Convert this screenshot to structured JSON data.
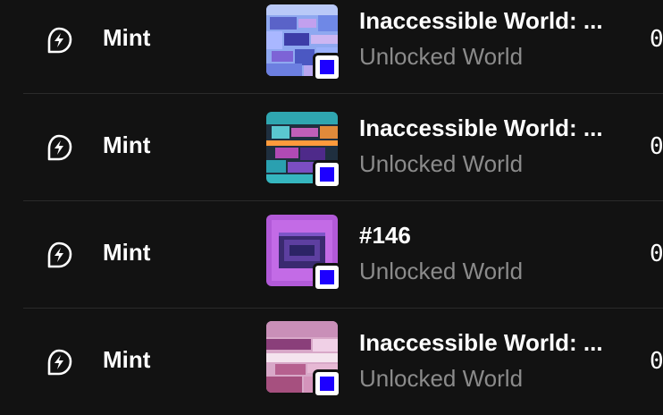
{
  "rows": [
    {
      "event_icon": "mint-lightning-leaf-icon",
      "event_label": "Mint",
      "item_name": "Inaccessible World: ...",
      "collection": "Unlocked World",
      "chain_badge_color": "#1d00ff",
      "price_partial": "0"
    },
    {
      "event_icon": "mint-lightning-leaf-icon",
      "event_label": "Mint",
      "item_name": "Inaccessible World: ...",
      "collection": "Unlocked World",
      "chain_badge_color": "#1d00ff",
      "price_partial": "0"
    },
    {
      "event_icon": "mint-lightning-leaf-icon",
      "event_label": "Mint",
      "item_name": "#146",
      "collection": "Unlocked World",
      "chain_badge_color": "#1d00ff",
      "price_partial": "0"
    },
    {
      "event_icon": "mint-lightning-leaf-icon",
      "event_label": "Mint",
      "item_name": "Inaccessible World: ...",
      "collection": "Unlocked World",
      "chain_badge_color": "#1d00ff",
      "price_partial": "0"
    }
  ],
  "colors": {
    "background": "#121212",
    "divider": "#2a2a2a",
    "primary_text": "#ffffff",
    "secondary_text": "#8b8b8b",
    "badge_accent": "#1d00ff"
  }
}
